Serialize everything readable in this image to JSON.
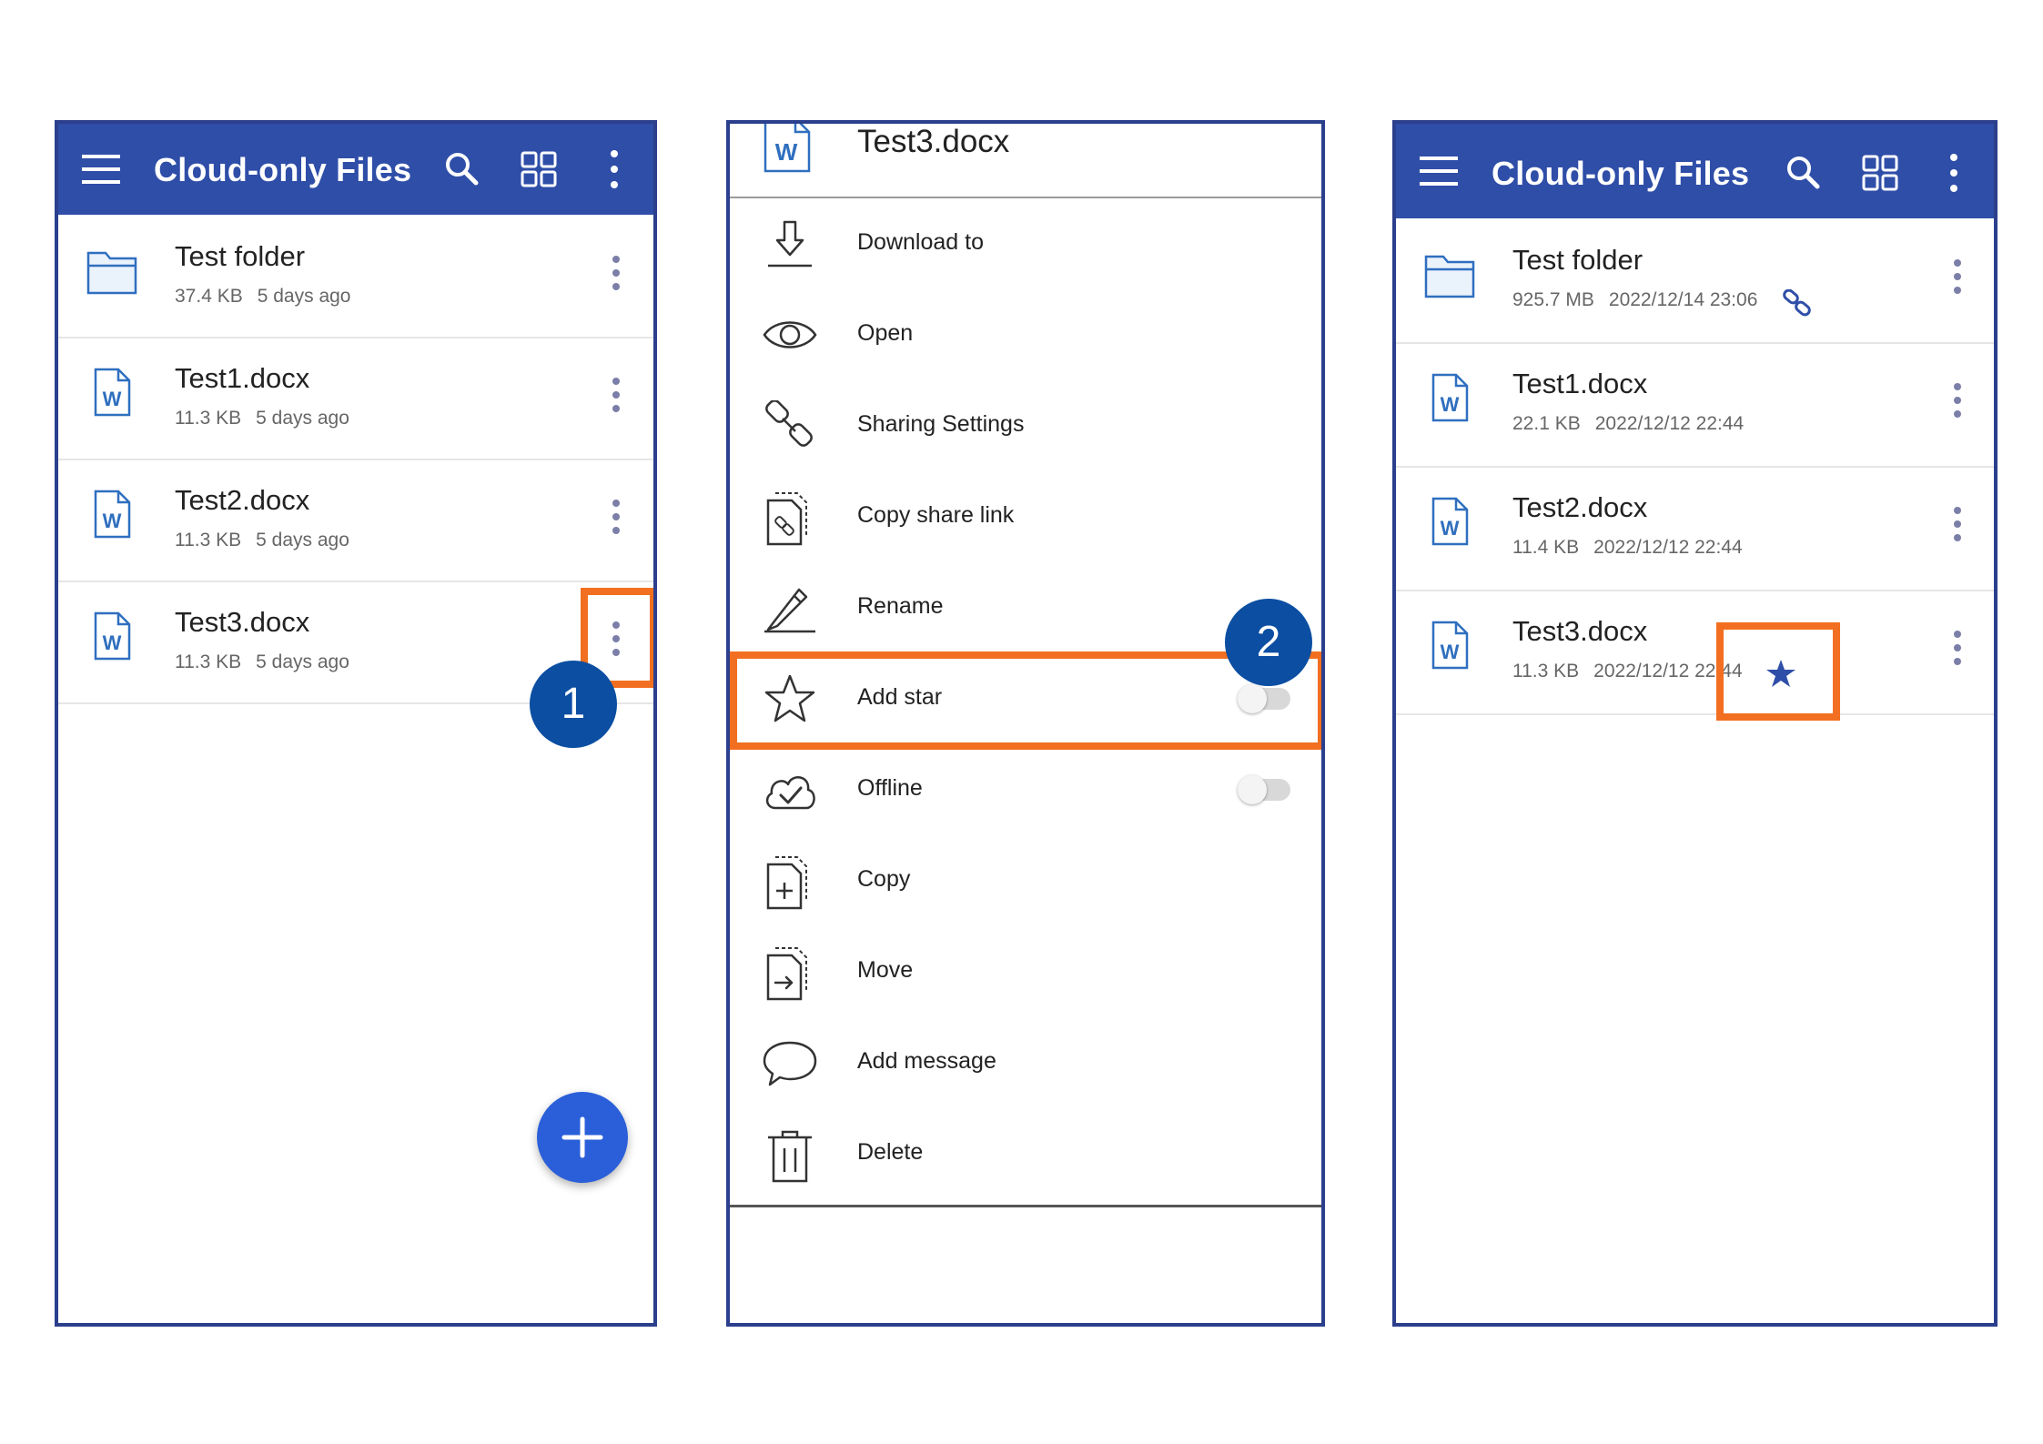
{
  "colors": {
    "appbar": "#2f4ea8",
    "highlight": "#f26f21",
    "badge": "#0b4ea2",
    "fab": "#2a5fd9"
  },
  "screen1": {
    "title": "Cloud-only Files",
    "files": [
      {
        "name": "Test folder",
        "size": "37.4 KB",
        "date": "5 days ago",
        "icon": "folder-icon"
      },
      {
        "name": "Test1.docx",
        "size": "11.3 KB",
        "date": "5 days ago",
        "icon": "word-doc-icon"
      },
      {
        "name": "Test2.docx",
        "size": "11.3 KB",
        "date": "5 days ago",
        "icon": "word-doc-icon"
      },
      {
        "name": "Test3.docx",
        "size": "11.3 KB",
        "date": "5 days ago",
        "icon": "word-doc-icon"
      }
    ],
    "step": "1",
    "fab_label": "+"
  },
  "screen2": {
    "file_name": "Test3.docx",
    "menu": [
      {
        "label": "Download to",
        "icon": "download-icon"
      },
      {
        "label": "Open",
        "icon": "eye-icon"
      },
      {
        "label": "Sharing Settings",
        "icon": "link-icon"
      },
      {
        "label": "Copy share link",
        "icon": "copy-link-icon"
      },
      {
        "label": "Rename",
        "icon": "pencil-icon"
      },
      {
        "label": "Add star",
        "icon": "star-icon",
        "toggle": false
      },
      {
        "label": "Offline",
        "icon": "cloud-check-icon",
        "toggle": false
      },
      {
        "label": "Copy",
        "icon": "copy-icon"
      },
      {
        "label": "Move",
        "icon": "move-icon"
      },
      {
        "label": "Add message",
        "icon": "message-icon"
      },
      {
        "label": "Delete",
        "icon": "trash-icon"
      }
    ],
    "step": "2"
  },
  "screen3": {
    "title": "Cloud-only Files",
    "files": [
      {
        "name": "Test folder",
        "size": "925.7 MB",
        "date": "2022/12/14 23:06",
        "icon": "folder-icon",
        "shared": true
      },
      {
        "name": "Test1.docx",
        "size": "22.1 KB",
        "date": "2022/12/12 22:44",
        "icon": "word-doc-icon"
      },
      {
        "name": "Test2.docx",
        "size": "11.4 KB",
        "date": "2022/12/12 22:44",
        "icon": "word-doc-icon"
      },
      {
        "name": "Test3.docx",
        "size": "11.3 KB",
        "date": "2022/12/12 22:44",
        "icon": "word-doc-icon",
        "starred": true
      }
    ]
  }
}
